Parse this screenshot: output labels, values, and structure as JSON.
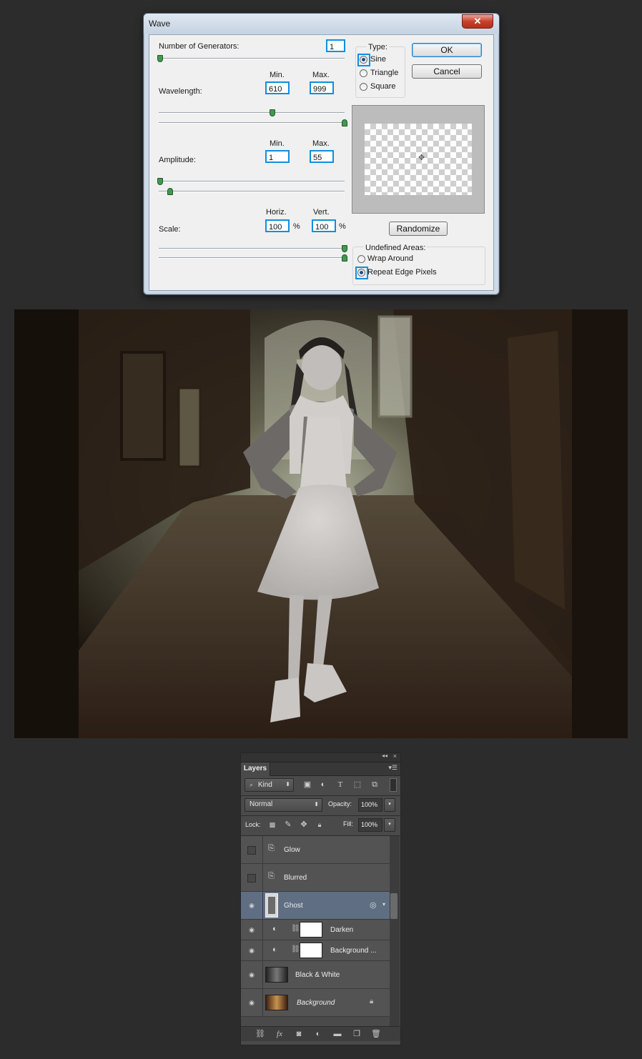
{
  "dialog": {
    "title": "Wave",
    "close_label": "✕",
    "generators_label": "Number of Generators:",
    "generators_value": "1",
    "generators_level": 0.0,
    "type": {
      "label": "Type:",
      "options": [
        "Sine",
        "Triangle",
        "Square"
      ],
      "selected": "Sine"
    },
    "ok_label": "OK",
    "cancel_label": "Cancel",
    "min_label": "Min.",
    "max_label": "Max.",
    "wavelength": {
      "label": "Wavelength:",
      "min": "610",
      "max": "999"
    },
    "amplitude": {
      "label": "Amplitude:",
      "min": "1",
      "max": "55"
    },
    "scale": {
      "label": "Scale:",
      "horiz_label": "Horiz.",
      "vert_label": "Vert.",
      "horiz": "100",
      "vert": "100",
      "unit": "%"
    },
    "randomize_label": "Randomize",
    "undefined_areas": {
      "label": "Undefined Areas:",
      "options": [
        "Wrap Around",
        "Repeat Edge Pixels"
      ],
      "selected": "Repeat Edge Pixels"
    }
  },
  "layers_panel": {
    "collapse_icon": "double-arrow-left-icon",
    "tab_label": "Layers",
    "filter_kind": "Kind",
    "blend_mode": "Normal",
    "opacity_label": "Opacity:",
    "opacity_value": "100%",
    "lock_label": "Lock:",
    "fill_label": "Fill:",
    "fill_value": "100%",
    "layers": [
      {
        "name": "Glow",
        "visible": false,
        "type": "smart-object"
      },
      {
        "name": "Blurred",
        "visible": false,
        "type": "smart-object"
      },
      {
        "name": "Ghost",
        "visible": true,
        "type": "smart-object",
        "selected": true
      },
      {
        "name": "Darken",
        "visible": true,
        "type": "adjustment"
      },
      {
        "name": "Background ...",
        "visible": true,
        "type": "adjustment"
      },
      {
        "name": "Black & White",
        "visible": true,
        "type": "image"
      },
      {
        "name": "Background",
        "visible": true,
        "type": "image",
        "locked": true
      }
    ]
  },
  "colors": {
    "focus_blue": "#0e8fe0",
    "slider_green": "#3f9a4f",
    "selected_layer": "#5f6e82"
  }
}
